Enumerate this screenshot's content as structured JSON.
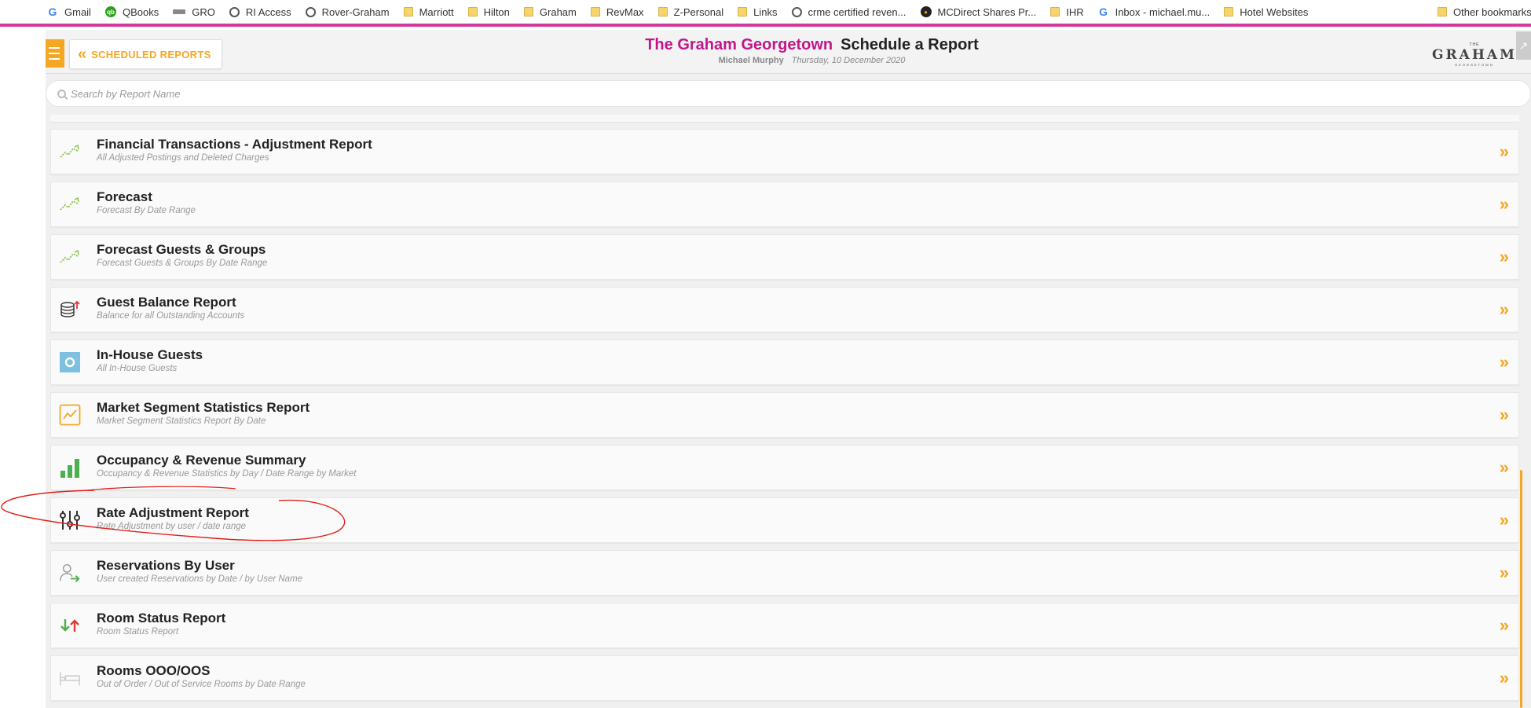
{
  "bookmarks": [
    {
      "label": "Gmail",
      "icon": "google-icon"
    },
    {
      "label": "QBooks",
      "icon": "qb-icon"
    },
    {
      "label": "GRO",
      "icon": "gro-icon"
    },
    {
      "label": "RI Access",
      "icon": "globe-icon"
    },
    {
      "label": "Rover-Graham",
      "icon": "globe-icon"
    },
    {
      "label": "Marriott",
      "icon": "folder-icon"
    },
    {
      "label": "Hilton",
      "icon": "folder-icon"
    },
    {
      "label": "Graham",
      "icon": "folder-icon"
    },
    {
      "label": "RevMax",
      "icon": "folder-icon"
    },
    {
      "label": "Z-Personal",
      "icon": "folder-icon"
    },
    {
      "label": "Links",
      "icon": "folder-icon"
    },
    {
      "label": "crme certified reven...",
      "icon": "globe-icon"
    },
    {
      "label": "MCDirect Shares Pr...",
      "icon": "mc-icon"
    },
    {
      "label": "IHR",
      "icon": "folder-icon"
    },
    {
      "label": "Inbox - michael.mu...",
      "icon": "google-icon"
    },
    {
      "label": "Hotel Websites",
      "icon": "folder-icon"
    }
  ],
  "other_bookmarks": "Other bookmarks",
  "header": {
    "back_label": "SCHEDULED REPORTS",
    "hotel_name": "The Graham Georgetown",
    "page_title": "Schedule a Report",
    "user": "Michael Murphy",
    "date": "Thursday, 10 December 2020",
    "logo_small": "THE",
    "logo_main": "GRAHAM",
    "logo_tag": "GEORGETOWN"
  },
  "search": {
    "placeholder": "Search by Report Name"
  },
  "reports": [
    {
      "title": "Financial Transactions - Adjustment Report",
      "subtitle": "All Adjusted Postings and Deleted Charges",
      "icon": "trend-up-icon"
    },
    {
      "title": "Forecast",
      "subtitle": "Forecast By Date Range",
      "icon": "trend-up-icon"
    },
    {
      "title": "Forecast Guests & Groups",
      "subtitle": "Forecast Guests & Groups By Date Range",
      "icon": "trend-up-icon"
    },
    {
      "title": "Guest Balance Report",
      "subtitle": "Balance for all Outstanding Accounts",
      "icon": "coins-icon"
    },
    {
      "title": "In-House Guests",
      "subtitle": "All In-House Guests",
      "icon": "in-house-icon"
    },
    {
      "title": "Market Segment Statistics Report",
      "subtitle": "Market Segment Statistics Report By Date",
      "icon": "line-chart-icon"
    },
    {
      "title": "Occupancy & Revenue Summary",
      "subtitle": "Occupancy & Revenue Statistics by Day / Date Range by Market",
      "icon": "bar-chart-icon"
    },
    {
      "title": "Rate Adjustment Report",
      "subtitle": "Rate Adjustment by user / date range",
      "icon": "sliders-icon"
    },
    {
      "title": "Reservations By User",
      "subtitle": "User created Reservations by Date / by User Name",
      "icon": "user-arrow-icon"
    },
    {
      "title": "Room Status Report",
      "subtitle": "Room Status Report",
      "icon": "up-down-arrows-icon"
    },
    {
      "title": "Rooms OOO/OOS",
      "subtitle": "Out of Order / Out of Service Rooms by Date Range",
      "icon": "bed-icon"
    }
  ],
  "colors": {
    "accent": "#f5a623",
    "brand": "#c0168c",
    "annotation": "#e0201a"
  }
}
